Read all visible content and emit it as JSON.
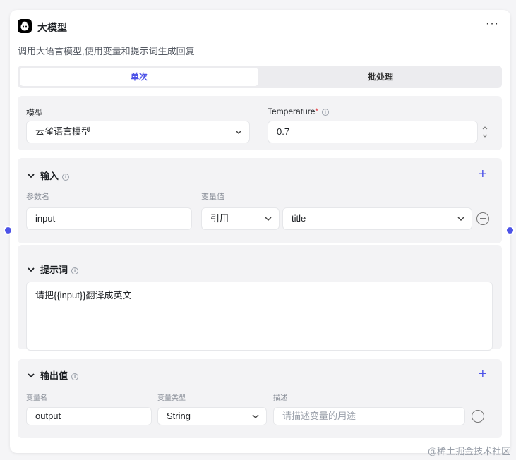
{
  "node": {
    "title": "大模型",
    "description": "调用大语言模型,使用变量和提示词生成回复",
    "more_icon": "more-horizontal-icon"
  },
  "tabs": [
    {
      "label": "单次",
      "active": true
    },
    {
      "label": "批处理",
      "active": false
    }
  ],
  "model": {
    "label": "模型",
    "value": "云雀语言模型",
    "temperature_label": "Temperature",
    "temperature_required": "*",
    "temperature_value": "0.7"
  },
  "input": {
    "title": "输入",
    "col_name": "参数名",
    "col_value": "变量值",
    "rows": [
      {
        "name": "input",
        "ref_type": "引用",
        "ref_value": "title"
      }
    ]
  },
  "prompt": {
    "title": "提示词",
    "text": "请把{{input}}翻译成英文"
  },
  "output": {
    "title": "输出值",
    "col_name": "变量名",
    "col_type": "变量类型",
    "col_desc": "描述",
    "rows": [
      {
        "name": "output",
        "type": "String",
        "desc_placeholder": "请描述变量的用途"
      }
    ]
  },
  "watermark": "@稀土掘金技术社区",
  "colors": {
    "accent": "#4d53e8",
    "port": "#4d53e8",
    "required": "#e5484d"
  }
}
